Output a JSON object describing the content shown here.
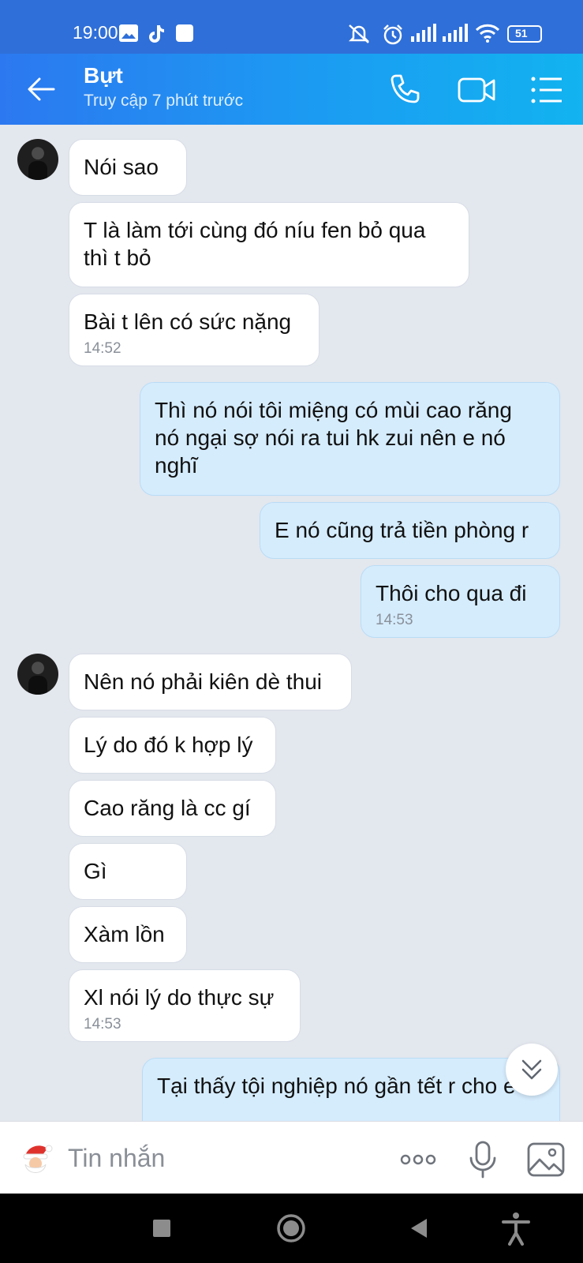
{
  "status_bar": {
    "time": "19:00",
    "battery": "51",
    "icons": [
      "image-icon",
      "tiktok-icon",
      "square-notification-icon",
      "mute-icon",
      "alarm-icon",
      "signal-icon",
      "signal-icon",
      "wifi-icon",
      "battery-icon"
    ]
  },
  "header": {
    "name": "Bựt",
    "status": "Truy cập 7 phút trước",
    "icons": [
      "back-arrow-icon",
      "phone-icon",
      "video-call-icon",
      "menu-icon"
    ]
  },
  "messages": [
    {
      "side": "in",
      "text": "Nói sao",
      "time": ""
    },
    {
      "side": "in",
      "text": "T là làm tới cùng đó níu fen bỏ qua\nthì t bỏ",
      "time": ""
    },
    {
      "side": "in",
      "text": "Bài t lên có sức nặng",
      "time": "14:52"
    },
    {
      "side": "out",
      "text": "Thì nó nói tôi miệng có mùi cao răng\nnó ngại sợ nói ra tui hk zui nên e nó\nnghĩ",
      "time": ""
    },
    {
      "side": "out",
      "text": "E nó cũng trả tiền phòng r",
      "time": ""
    },
    {
      "side": "out",
      "text": "Thôi cho qua đi",
      "time": "14:53"
    },
    {
      "side": "in",
      "text": "Nên nó phải kiên dè thui",
      "time": ""
    },
    {
      "side": "in",
      "text": "Lý do đó k hợp lý",
      "time": ""
    },
    {
      "side": "in",
      "text": "Cao răng là cc gí",
      "time": ""
    },
    {
      "side": "in",
      "text": "Gì",
      "time": ""
    },
    {
      "side": "in",
      "text": "Xàm lồn",
      "time": ""
    },
    {
      "side": "in",
      "text": "Xl nói lý do thực sự",
      "time": "14:53"
    },
    {
      "side": "out",
      "text": "Tại thấy tội nghiệp nó gần tết r cho e",
      "time": ""
    }
  ],
  "input_bar": {
    "placeholder": "Tin nhắn",
    "icons": [
      "santa-sticker-icon",
      "more-options-icon",
      "microphone-icon",
      "image-gallery-icon"
    ]
  },
  "nav_bar": {
    "icons": [
      "recent-apps-icon",
      "home-icon",
      "back-icon",
      "accessibility-icon"
    ]
  },
  "colors": {
    "header_start": "#2c78f0",
    "header_end": "#12b3f0",
    "chat_background": "#e3e7ee",
    "incoming_bubble": "#ffffff",
    "outgoing_bubble": "#d5ecfd"
  }
}
